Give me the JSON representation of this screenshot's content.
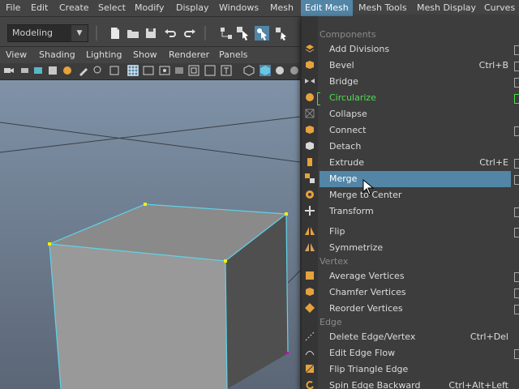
{
  "menubar": [
    "File",
    "Edit",
    "Create",
    "Select",
    "Modify",
    "Display",
    "Windows",
    "Mesh",
    "Edit Mesh",
    "Mesh Tools",
    "Mesh Display",
    "Curves"
  ],
  "active_menu": "Edit Mesh",
  "mode": "Modeling",
  "panel_menu": [
    "View",
    "Shading",
    "Lighting",
    "Show",
    "Renderer",
    "Panels"
  ],
  "dropdown": {
    "sections": {
      "components": "Components",
      "vertex": "Vertex",
      "edge": "Edge"
    },
    "items": [
      {
        "label": "Add Divisions",
        "shortcut": "",
        "box": true
      },
      {
        "label": "Bevel",
        "shortcut": "Ctrl+B",
        "box": true
      },
      {
        "label": "Bridge",
        "shortcut": "",
        "box": true
      },
      {
        "label": "Circularize",
        "shortcut": "",
        "box": true
      },
      {
        "label": "Collapse",
        "shortcut": "",
        "box": false
      },
      {
        "label": "Connect",
        "shortcut": "",
        "box": true
      },
      {
        "label": "Detach",
        "shortcut": "",
        "box": false
      },
      {
        "label": "Extrude",
        "shortcut": "Ctrl+E",
        "box": true
      },
      {
        "label": "Merge",
        "shortcut": "",
        "box": true
      },
      {
        "label": "Merge to Center",
        "shortcut": "",
        "box": false
      },
      {
        "label": "Transform",
        "shortcut": "",
        "box": true
      },
      {
        "label": "Flip",
        "shortcut": "",
        "box": true
      },
      {
        "label": "Symmetrize",
        "shortcut": "",
        "box": false
      },
      {
        "label": "Average Vertices",
        "shortcut": "",
        "box": true
      },
      {
        "label": "Chamfer Vertices",
        "shortcut": "",
        "box": true
      },
      {
        "label": "Reorder Vertices",
        "shortcut": "",
        "box": true
      },
      {
        "label": "Delete Edge/Vertex",
        "shortcut": "Ctrl+Del",
        "box": false
      },
      {
        "label": "Edit Edge Flow",
        "shortcut": "",
        "box": true
      },
      {
        "label": "Flip Triangle Edge",
        "shortcut": "",
        "box": false
      },
      {
        "label": "Spin Edge Backward",
        "shortcut": "Ctrl+Alt+Left",
        "box": false
      }
    ],
    "highlighted": "Merge",
    "active_green": "Circularize"
  },
  "colors": {
    "highlight": "#5285a6",
    "green": "#4de04d",
    "menu_bg": "#3d3d3d",
    "wireframe": "#5fd3e8",
    "vertex": "#f0f000"
  }
}
